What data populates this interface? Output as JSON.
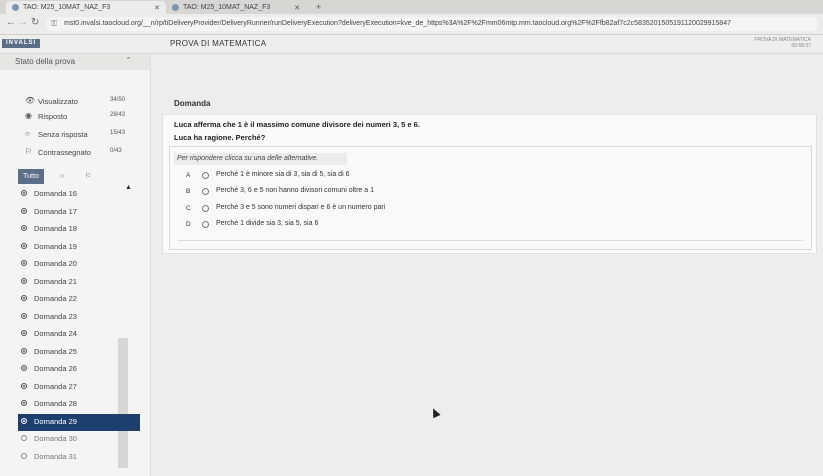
{
  "browser": {
    "tabs": [
      {
        "title": "TAO: M25_10MAT_NAZ_F3",
        "active": true
      },
      {
        "title": "TAO: M25_10MAT_NAZ_F3",
        "active": false
      }
    ],
    "new_tab": "+",
    "url": "mst0.invalsi.taocloud.org/__n/rp/tiDeliveryProvider/DeliveryRunner/runDeliveryExecution?deliveryExecution=kve_de_https%3A%2F%2Fmm06mtp.mm.taocloud.org%2F%2Ffb82af7c2c5835201505191120029915847"
  },
  "app": {
    "logo": "INVALSI",
    "title": "PROVA DI MATEMATICA",
    "right_label": "PROVA DI MATEMATICA",
    "right_time": "00:58:37"
  },
  "sidebar": {
    "header": "Stato della prova",
    "stats": [
      {
        "icon": "eye-icon",
        "glyph": "👁",
        "label": "Visualizzato",
        "value": "34/50"
      },
      {
        "icon": "answered-icon",
        "glyph": "◉",
        "label": "Risposto",
        "value": "28/43"
      },
      {
        "icon": "unanswered-icon",
        "glyph": "○",
        "label": "Senza risposta",
        "value": "15/43"
      },
      {
        "icon": "flag-icon",
        "glyph": "⚐",
        "label": "Contrassegnato",
        "value": "0/43"
      }
    ],
    "filters": {
      "all": "Tutto",
      "unanswered_glyph": "○",
      "flag_glyph": "⚐"
    },
    "questions": [
      {
        "label": "Domanda 16",
        "state": "answered"
      },
      {
        "label": "Domanda 17",
        "state": "answered"
      },
      {
        "label": "Domanda 18",
        "state": "answered"
      },
      {
        "label": "Domanda 19",
        "state": "answered"
      },
      {
        "label": "Domanda 20",
        "state": "answered"
      },
      {
        "label": "Domanda 21",
        "state": "answered"
      },
      {
        "label": "Domanda 22",
        "state": "answered"
      },
      {
        "label": "Domanda 23",
        "state": "answered"
      },
      {
        "label": "Domanda 24",
        "state": "answered"
      },
      {
        "label": "Domanda 25",
        "state": "answered"
      },
      {
        "label": "Domanda 26",
        "state": "answered"
      },
      {
        "label": "Domanda 27",
        "state": "answered"
      },
      {
        "label": "Domanda 28",
        "state": "answered"
      },
      {
        "label": "Domanda 29",
        "state": "current"
      },
      {
        "label": "Domanda 30",
        "state": "unanswered"
      },
      {
        "label": "Domanda 31",
        "state": "unanswered"
      }
    ]
  },
  "main": {
    "section_label": "Domanda",
    "question_line1": "Luca afferma che 1 è il massimo comune divisore dei numeri 3, 5 e 6.",
    "question_line2": "Luca ha ragione. Perché?",
    "instruction": "Per rispondere clicca su una delle alternative.",
    "options": [
      {
        "letter": "A",
        "text": "Perché 1 è minore sia di 3, sia di 5, sia di 6"
      },
      {
        "letter": "B",
        "text": "Perché 3, 6 e 5 non hanno divisori comuni oltre a 1"
      },
      {
        "letter": "C",
        "text": "Perché 3 e 5 sono numeri dispari e 6 è un numero pari"
      },
      {
        "letter": "D",
        "text": "Perché 1 divide sia 3, sia 5, sia 6"
      }
    ]
  },
  "colors": {
    "current_item_bg": "#1d3f6e",
    "logo_bg": "#5a6f87",
    "filter_active_bg": "#5b6f88"
  }
}
